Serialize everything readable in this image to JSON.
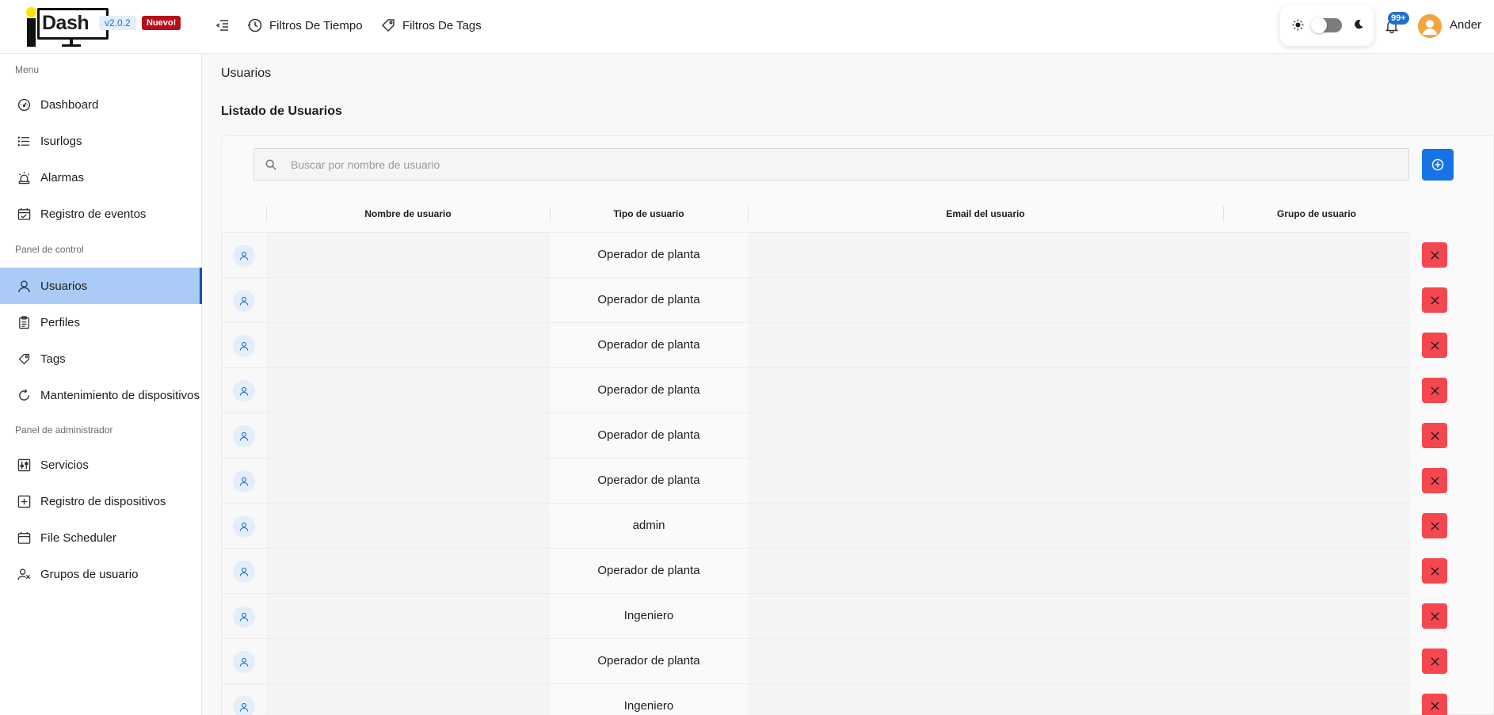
{
  "header": {
    "logo_text": "Dash",
    "version": "v2.0.2",
    "new_badge": "Nuevo!",
    "time_filters": "Filtros De Tiempo",
    "tag_filters": "Filtros De Tags",
    "notifications": "99+",
    "user": "Ander"
  },
  "sidebar": {
    "section_menu": "Menu",
    "section_control": "Panel de control",
    "section_admin": "Panel de administrador",
    "items": {
      "dashboard": "Dashboard",
      "isurlogs": "Isurlogs",
      "alarmas": "Alarmas",
      "registro_eventos": "Registro de eventos",
      "usuarios": "Usuarios",
      "perfiles": "Perfiles",
      "tags": "Tags",
      "mantenimiento": "Mantenimiento de dispositivos",
      "servicios": "Servicios",
      "registro_dispositivos": "Registro de dispositivos",
      "file_scheduler": "File Scheduler",
      "grupos_usuario": "Grupos de usuario"
    },
    "active": "Usuarios"
  },
  "main": {
    "breadcrumb": "Usuarios",
    "title": "Listado de Usuarios",
    "search_placeholder": "Buscar por nombre de usuario",
    "columns": {
      "name": "Nombre de usuario",
      "type": "Tipo de usuario",
      "email": "Email del usuario",
      "group": "Grupo de usuario"
    },
    "rows": [
      {
        "type": "Operador de planta"
      },
      {
        "type": "Operador de planta"
      },
      {
        "type": "Operador de planta"
      },
      {
        "type": "Operador de planta"
      },
      {
        "type": "Operador de planta"
      },
      {
        "type": "Operador de planta"
      },
      {
        "type": "admin"
      },
      {
        "type": "Operador de planta"
      },
      {
        "type": "Ingeniero"
      },
      {
        "type": "Operador de planta"
      },
      {
        "type": "Ingeniero"
      }
    ]
  },
  "colors": {
    "accent": "#1673e6",
    "active_nav": "#a9cbf5",
    "delete": "#f5474f",
    "new_badge": "#b50e1a"
  }
}
